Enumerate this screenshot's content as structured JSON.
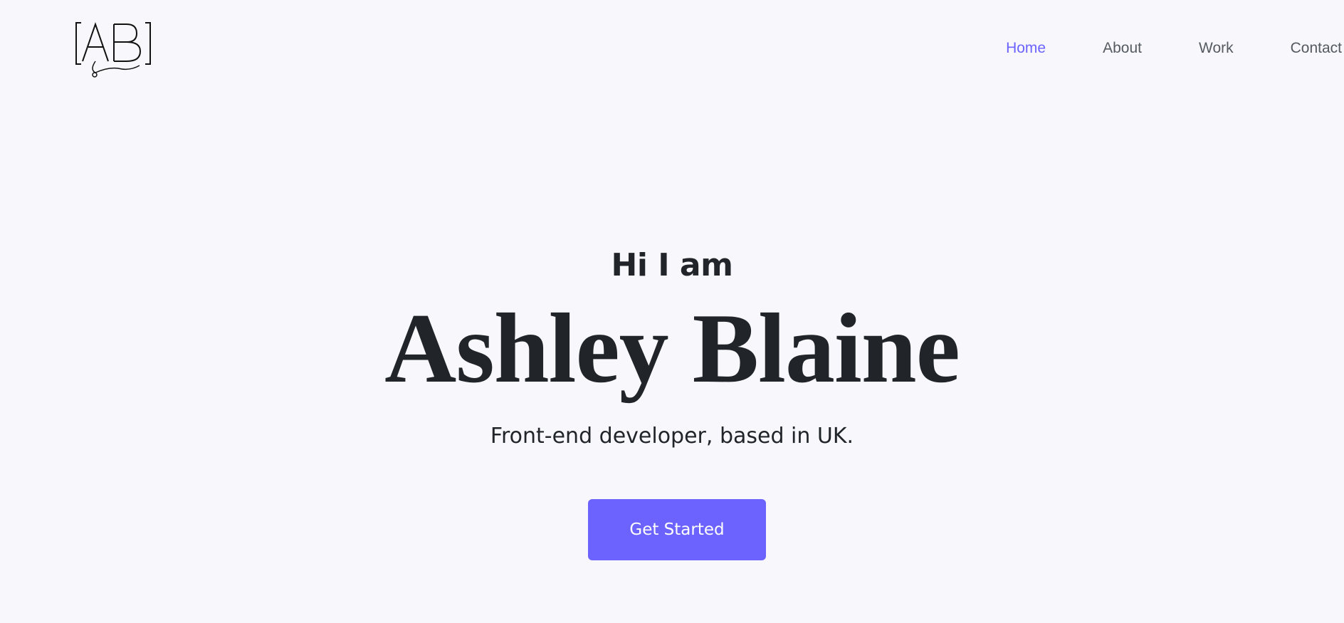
{
  "header": {
    "logo_text": "AB"
  },
  "nav": {
    "items": [
      {
        "label": "Home",
        "active": true
      },
      {
        "label": "About",
        "active": false
      },
      {
        "label": "Work",
        "active": false
      },
      {
        "label": "Contact",
        "active": false
      }
    ]
  },
  "hero": {
    "greeting": "Hi I am",
    "name": "Ashley Blaine",
    "tagline": "Front-end developer, based in UK.",
    "cta_label": "Get Started"
  },
  "colors": {
    "background": "#f8f8fc",
    "accent": "#6c63ff",
    "text": "#212529",
    "nav_text": "#555a61"
  }
}
